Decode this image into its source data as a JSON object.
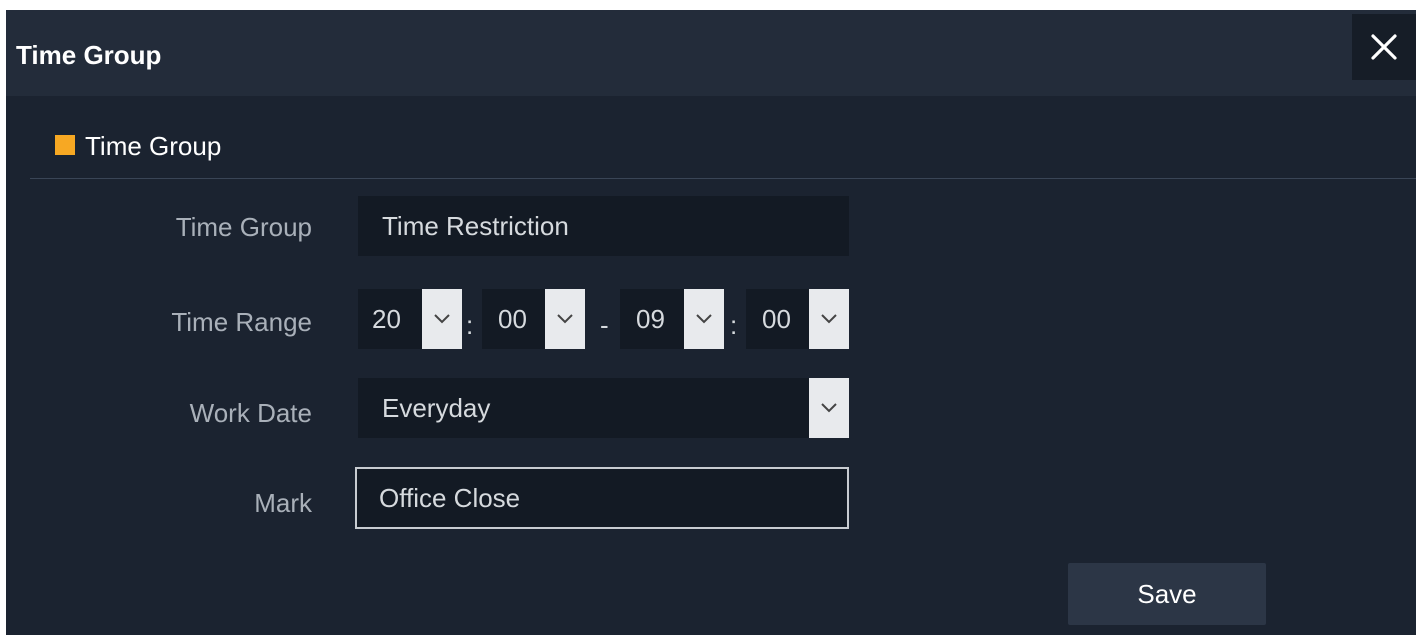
{
  "dialog": {
    "title": "Time Group",
    "close_icon": "close-icon"
  },
  "section": {
    "title": "Time Group",
    "accent_color": "#f7a823"
  },
  "form": {
    "time_group": {
      "label": "Time Group",
      "value": "Time Restriction"
    },
    "time_range": {
      "label": "Time Range",
      "start_hour": "20",
      "start_minute": "00",
      "end_hour": "09",
      "end_minute": "00",
      "colon": ":",
      "dash": "-"
    },
    "work_date": {
      "label": "Work Date",
      "value": "Everyday"
    },
    "mark": {
      "label": "Mark",
      "value": "Office Close"
    }
  },
  "actions": {
    "save_label": "Save"
  }
}
